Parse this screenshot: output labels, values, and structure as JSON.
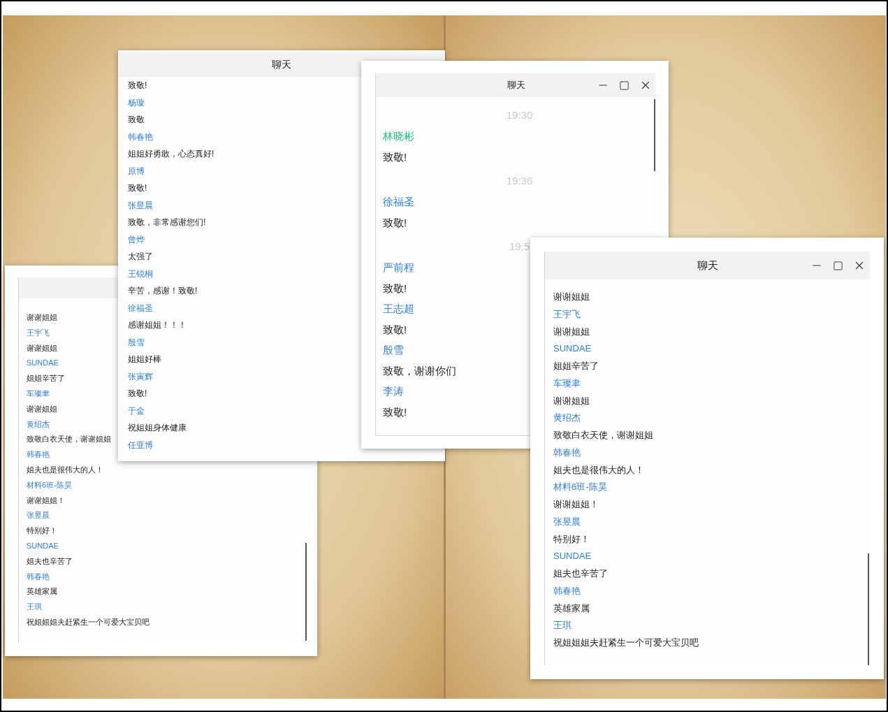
{
  "windows": [
    {
      "lines": [
        {
          "kind": "text",
          "text": "谢谢姐姐"
        },
        {
          "kind": "name",
          "text": "王宇飞"
        },
        {
          "kind": "text",
          "text": "谢谢姐姐"
        },
        {
          "kind": "name",
          "text": "SUNDAE"
        },
        {
          "kind": "text",
          "text": "姐姐辛苦了"
        },
        {
          "kind": "name",
          "text": "车璨聿"
        },
        {
          "kind": "text",
          "text": "谢谢姐姐"
        },
        {
          "kind": "name",
          "text": "黄绍杰"
        },
        {
          "kind": "text",
          "text": "致敬白衣天使，谢谢姐姐"
        },
        {
          "kind": "name",
          "text": "韩春艳"
        },
        {
          "kind": "text",
          "text": "姐夫也是很伟大的人！"
        },
        {
          "kind": "name",
          "text": "材料6班-陈昊"
        },
        {
          "kind": "text",
          "text": "谢谢姐姐！"
        },
        {
          "kind": "name",
          "text": "张昱晨"
        },
        {
          "kind": "text",
          "text": "特别好！"
        },
        {
          "kind": "name",
          "text": "SUNDAE"
        },
        {
          "kind": "text",
          "text": "姐夫也辛苦了"
        },
        {
          "kind": "name",
          "text": "韩春艳"
        },
        {
          "kind": "text",
          "text": "英雄家属"
        },
        {
          "kind": "name",
          "text": "王琪"
        },
        {
          "kind": "text",
          "text": "祝姐姐姐夫赶紧生一个可爱大宝贝吧"
        }
      ]
    },
    {
      "title": "聊天",
      "lines": [
        {
          "kind": "text",
          "text": "致敬!"
        },
        {
          "kind": "name",
          "text": "杨璇"
        },
        {
          "kind": "text",
          "text": "致敬"
        },
        {
          "kind": "name",
          "text": "韩春艳"
        },
        {
          "kind": "text",
          "text": "姐姐好勇敢，心态真好!"
        },
        {
          "kind": "name",
          "text": "原博"
        },
        {
          "kind": "text",
          "text": "致敬!"
        },
        {
          "kind": "name",
          "text": "张昱晨"
        },
        {
          "kind": "text",
          "text": "致敬，非常感谢您们!"
        },
        {
          "kind": "name",
          "text": "曾烨"
        },
        {
          "kind": "text",
          "text": "太强了"
        },
        {
          "kind": "name",
          "text": "王锐桐"
        },
        {
          "kind": "text",
          "text": "辛苦，感谢！致敬!"
        },
        {
          "kind": "name",
          "text": "徐福圣"
        },
        {
          "kind": "text",
          "text": "感谢姐姐！！！"
        },
        {
          "kind": "name",
          "text": "殷雪"
        },
        {
          "kind": "text",
          "text": "姐姐好棒"
        },
        {
          "kind": "name",
          "text": "张寅辉"
        },
        {
          "kind": "text",
          "text": "致敬!"
        },
        {
          "kind": "name",
          "text": "于金"
        },
        {
          "kind": "text",
          "text": "祝姐姐身体健康"
        },
        {
          "kind": "name",
          "text": "任亚博"
        }
      ]
    },
    {
      "title": "聊天",
      "controls": true,
      "lines": [
        {
          "kind": "time",
          "text": "19:30"
        },
        {
          "kind": "name",
          "text": "林晓彬",
          "color": "#22c07a"
        },
        {
          "kind": "text",
          "text": "致敬!"
        },
        {
          "kind": "time",
          "text": "19:36"
        },
        {
          "kind": "name",
          "text": "徐福圣",
          "color": "#2f7fd8"
        },
        {
          "kind": "text",
          "text": "致敬!"
        },
        {
          "kind": "time",
          "text": "19:5"
        },
        {
          "kind": "name",
          "text": "严前程",
          "color": "#2f7fd8"
        },
        {
          "kind": "text",
          "text": "致敬!"
        },
        {
          "kind": "name",
          "text": "王志超",
          "color": "#2f7fd8"
        },
        {
          "kind": "text",
          "text": "致敬!"
        },
        {
          "kind": "name",
          "text": "殷雪",
          "color": "#2f7fd8"
        },
        {
          "kind": "text",
          "text": "致敬，谢谢你们"
        },
        {
          "kind": "name",
          "text": "李涛",
          "color": "#2f7fd8"
        },
        {
          "kind": "text",
          "text": "致敬!"
        }
      ]
    },
    {
      "title": "聊天",
      "controls": true,
      "lines": [
        {
          "kind": "text",
          "text": "谢谢姐姐"
        },
        {
          "kind": "name",
          "text": "王宇飞"
        },
        {
          "kind": "text",
          "text": "谢谢姐姐"
        },
        {
          "kind": "name",
          "text": "SUNDAE"
        },
        {
          "kind": "text",
          "text": "姐姐辛苦了"
        },
        {
          "kind": "name",
          "text": "车璨聿"
        },
        {
          "kind": "text",
          "text": "谢谢姐姐"
        },
        {
          "kind": "name",
          "text": "黄绍杰"
        },
        {
          "kind": "text",
          "text": "致敬白衣天使，谢谢姐姐"
        },
        {
          "kind": "name",
          "text": "韩春艳"
        },
        {
          "kind": "text",
          "text": "姐夫也是很伟大的人！"
        },
        {
          "kind": "name",
          "text": "材料6班-陈昊"
        },
        {
          "kind": "text",
          "text": "谢谢姐姐！"
        },
        {
          "kind": "name",
          "text": "张昱晨"
        },
        {
          "kind": "text",
          "text": "特别好！"
        },
        {
          "kind": "name",
          "text": "SUNDAE"
        },
        {
          "kind": "text",
          "text": "姐夫也辛苦了"
        },
        {
          "kind": "name",
          "text": "韩春艳"
        },
        {
          "kind": "text",
          "text": "英雄家属"
        },
        {
          "kind": "name",
          "text": "王琪"
        },
        {
          "kind": "text",
          "text": "祝姐姐姐夫赶紧生一个可爱大宝贝吧"
        }
      ]
    }
  ]
}
